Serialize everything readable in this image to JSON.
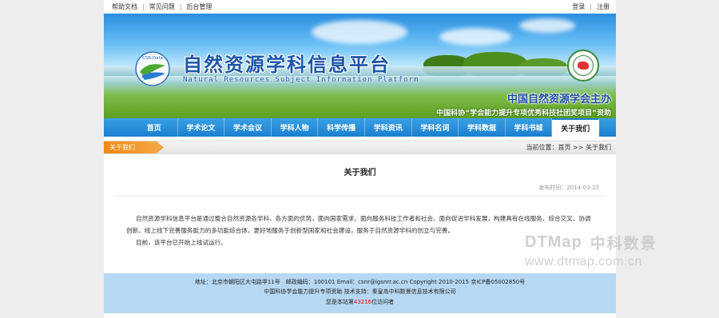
{
  "topbar": {
    "links": [
      "帮助文档",
      "常见问题",
      "后台管理"
    ],
    "login": "登录",
    "register": "注册"
  },
  "banner": {
    "logo_text": "CSR-Data",
    "title": "自然资源学科信息平台",
    "subtitle": "Natural Resources Subject Information Platform",
    "host": "中国自然资源学会主办",
    "funding": "中国科协“学会能力提升专项优秀科技社团奖项目”资助"
  },
  "nav": {
    "items": [
      "首页",
      "学术论文",
      "学术会议",
      "学科人物",
      "科学传播",
      "学科资讯",
      "学科名词",
      "学科数据",
      "学科书城",
      "关于我们"
    ],
    "active": "关于我们"
  },
  "breadcrumb": {
    "section": "关于我们",
    "location_label": "当前位置：",
    "home": "首页",
    "separator": " >> ",
    "current": "关于我们"
  },
  "article": {
    "title": "关于我们",
    "date_label": "发布时间：",
    "date": "2014-03-27",
    "paragraphs": [
      "自然资源学科信息平台是通过整合自然资源各学科、各方面的优势，面向国家需求、面向服务科技工作者和社会、面向促进学科发展，构建具有在线服务、综合交叉、协调创新、线上线下完善服务能力的多功能综合体，更好地服务于创新型国家和社会建设，服务于自然资源学科的创立与完善。",
      "目前，该平台已开始上线试运行。"
    ]
  },
  "footer": {
    "address": "地址：北京市朝阳区大屯路甲11号　邮政编码：100101 Email：csnr@igsnrr.ac.cn Copyright 2010-2015 京ICP备05002850号",
    "support": "中国科协学会能力提升专项资助 技术支持：秦皇岛中科数景信息技术有限公司",
    "visitor_prefix": "您是本站第",
    "visitor_count": "43216",
    "visitor_suffix": "位访问者"
  },
  "watermark": {
    "logo": "DTMap",
    "name": "中科数景",
    "url": "www.dtmap.com.cn"
  }
}
